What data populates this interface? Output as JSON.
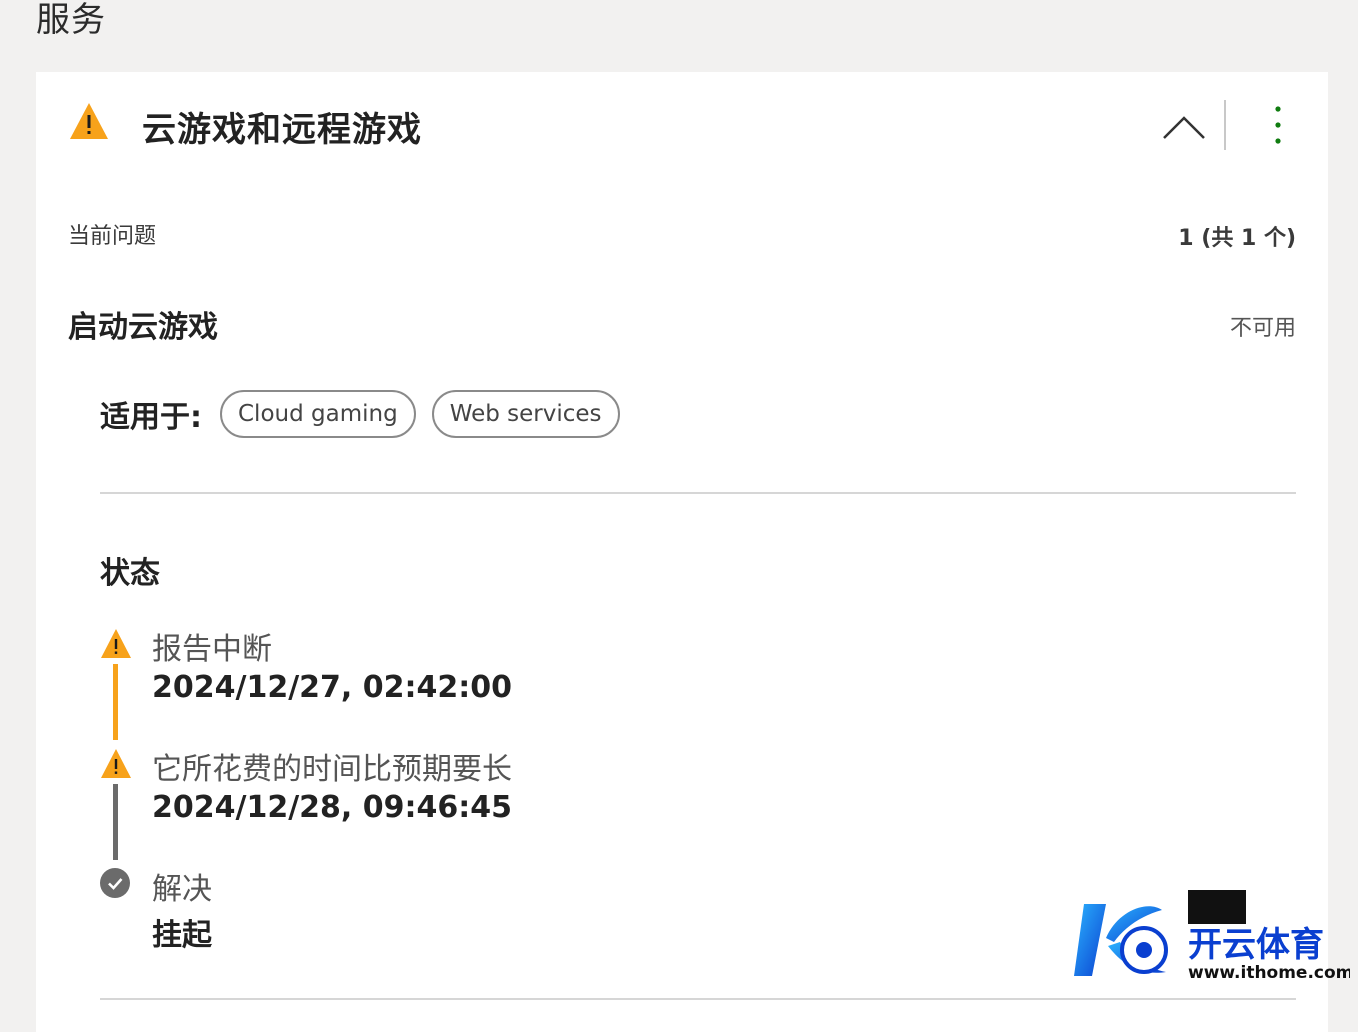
{
  "page": {
    "heading": "服务"
  },
  "card": {
    "title": "云游戏和远程游戏",
    "current_issues_label": "当前问题",
    "issues_count": "1 (共 1 个)",
    "issue": {
      "title": "启动云游戏",
      "status": "不可用",
      "applies_to_label": "适用于:",
      "tags": [
        "Cloud gaming",
        "Web services"
      ]
    },
    "status_section": {
      "heading": "状态",
      "timeline": [
        {
          "label": "报告中断",
          "value": "2024/12/27, 02:42:00",
          "icon": "warning-icon"
        },
        {
          "label": "它所花费的时间比预期要长",
          "value": "2024/12/28, 09:46:45",
          "icon": "warning-icon"
        },
        {
          "label": "解决",
          "value": "挂起",
          "icon": "check-circle-icon"
        }
      ]
    }
  },
  "watermark": {
    "text": "开云体育",
    "url": "www.ithome.com"
  },
  "colors": {
    "warning": "#f7a21b",
    "accent_green": "#107c10",
    "timeline_grey": "#6b6b6b",
    "page_bg": "#f2f1f0"
  }
}
